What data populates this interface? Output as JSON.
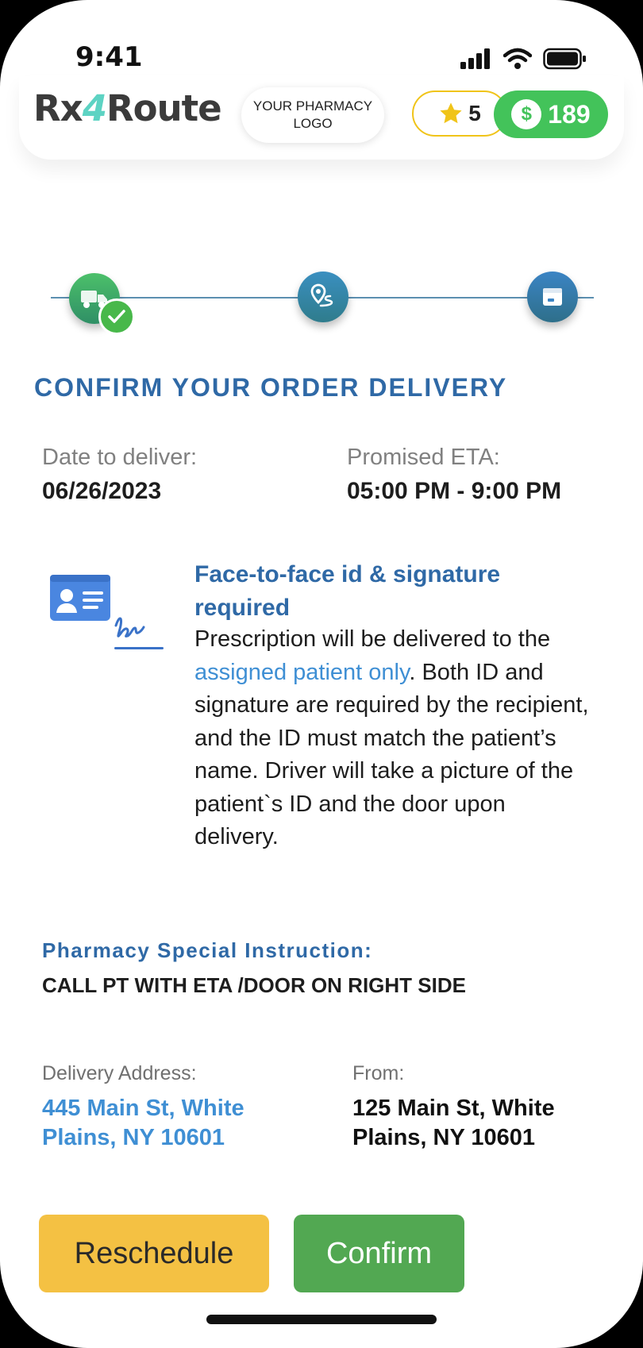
{
  "status_bar": {
    "time": "9:41"
  },
  "header": {
    "brand": {
      "part1": "Rx",
      "part2": "4",
      "part3": "Route"
    },
    "pharmacy_logo": "YOUR PHARMACY\nLOGO",
    "rating": "5",
    "coins": "189",
    "coin_symbol": "$"
  },
  "stepper": {
    "steps": [
      {
        "icon": "truck-icon",
        "status": "completed"
      },
      {
        "icon": "location-route-icon",
        "status": "current"
      },
      {
        "icon": "box-icon",
        "status": "pending"
      }
    ]
  },
  "main": {
    "title": "CONFIRM YOUR ORDER DELIVERY",
    "date_label": "Date to deliver:",
    "date_value": "06/26/2023",
    "eta_label": "Promised ETA:",
    "eta_value": "05:00 PM - 9:00 PM"
  },
  "requirement": {
    "title": "Face-to-face id & signature required",
    "body_before": "Prescription will be delivered to the ",
    "body_link": "assigned patient only",
    "body_after": ". Both ID and signature are required by the recipient, and the ID must match the patient’s name. Driver will take a picture of the patient`s ID and the door upon delivery."
  },
  "instruction": {
    "label": "Pharmacy Special Instruction:",
    "text": "CALL PT WITH ETA /DOOR ON RIGHT SIDE"
  },
  "addresses": {
    "delivery_label": "Delivery Address:",
    "delivery_value": "445 Main St, White Plains, NY 10601",
    "from_label": "From:",
    "from_value": "125 Main St, White Plains, NY 10601"
  },
  "actions": {
    "reschedule": "Reschedule",
    "confirm": "Confirm"
  },
  "colors": {
    "primary_blue": "#2f69a6",
    "link_blue": "#3f8fd4",
    "confirm_green": "#52a852",
    "reschedule_yellow": "#f4c143",
    "coins_green": "#43c35a",
    "star_yellow": "#f0c419"
  }
}
